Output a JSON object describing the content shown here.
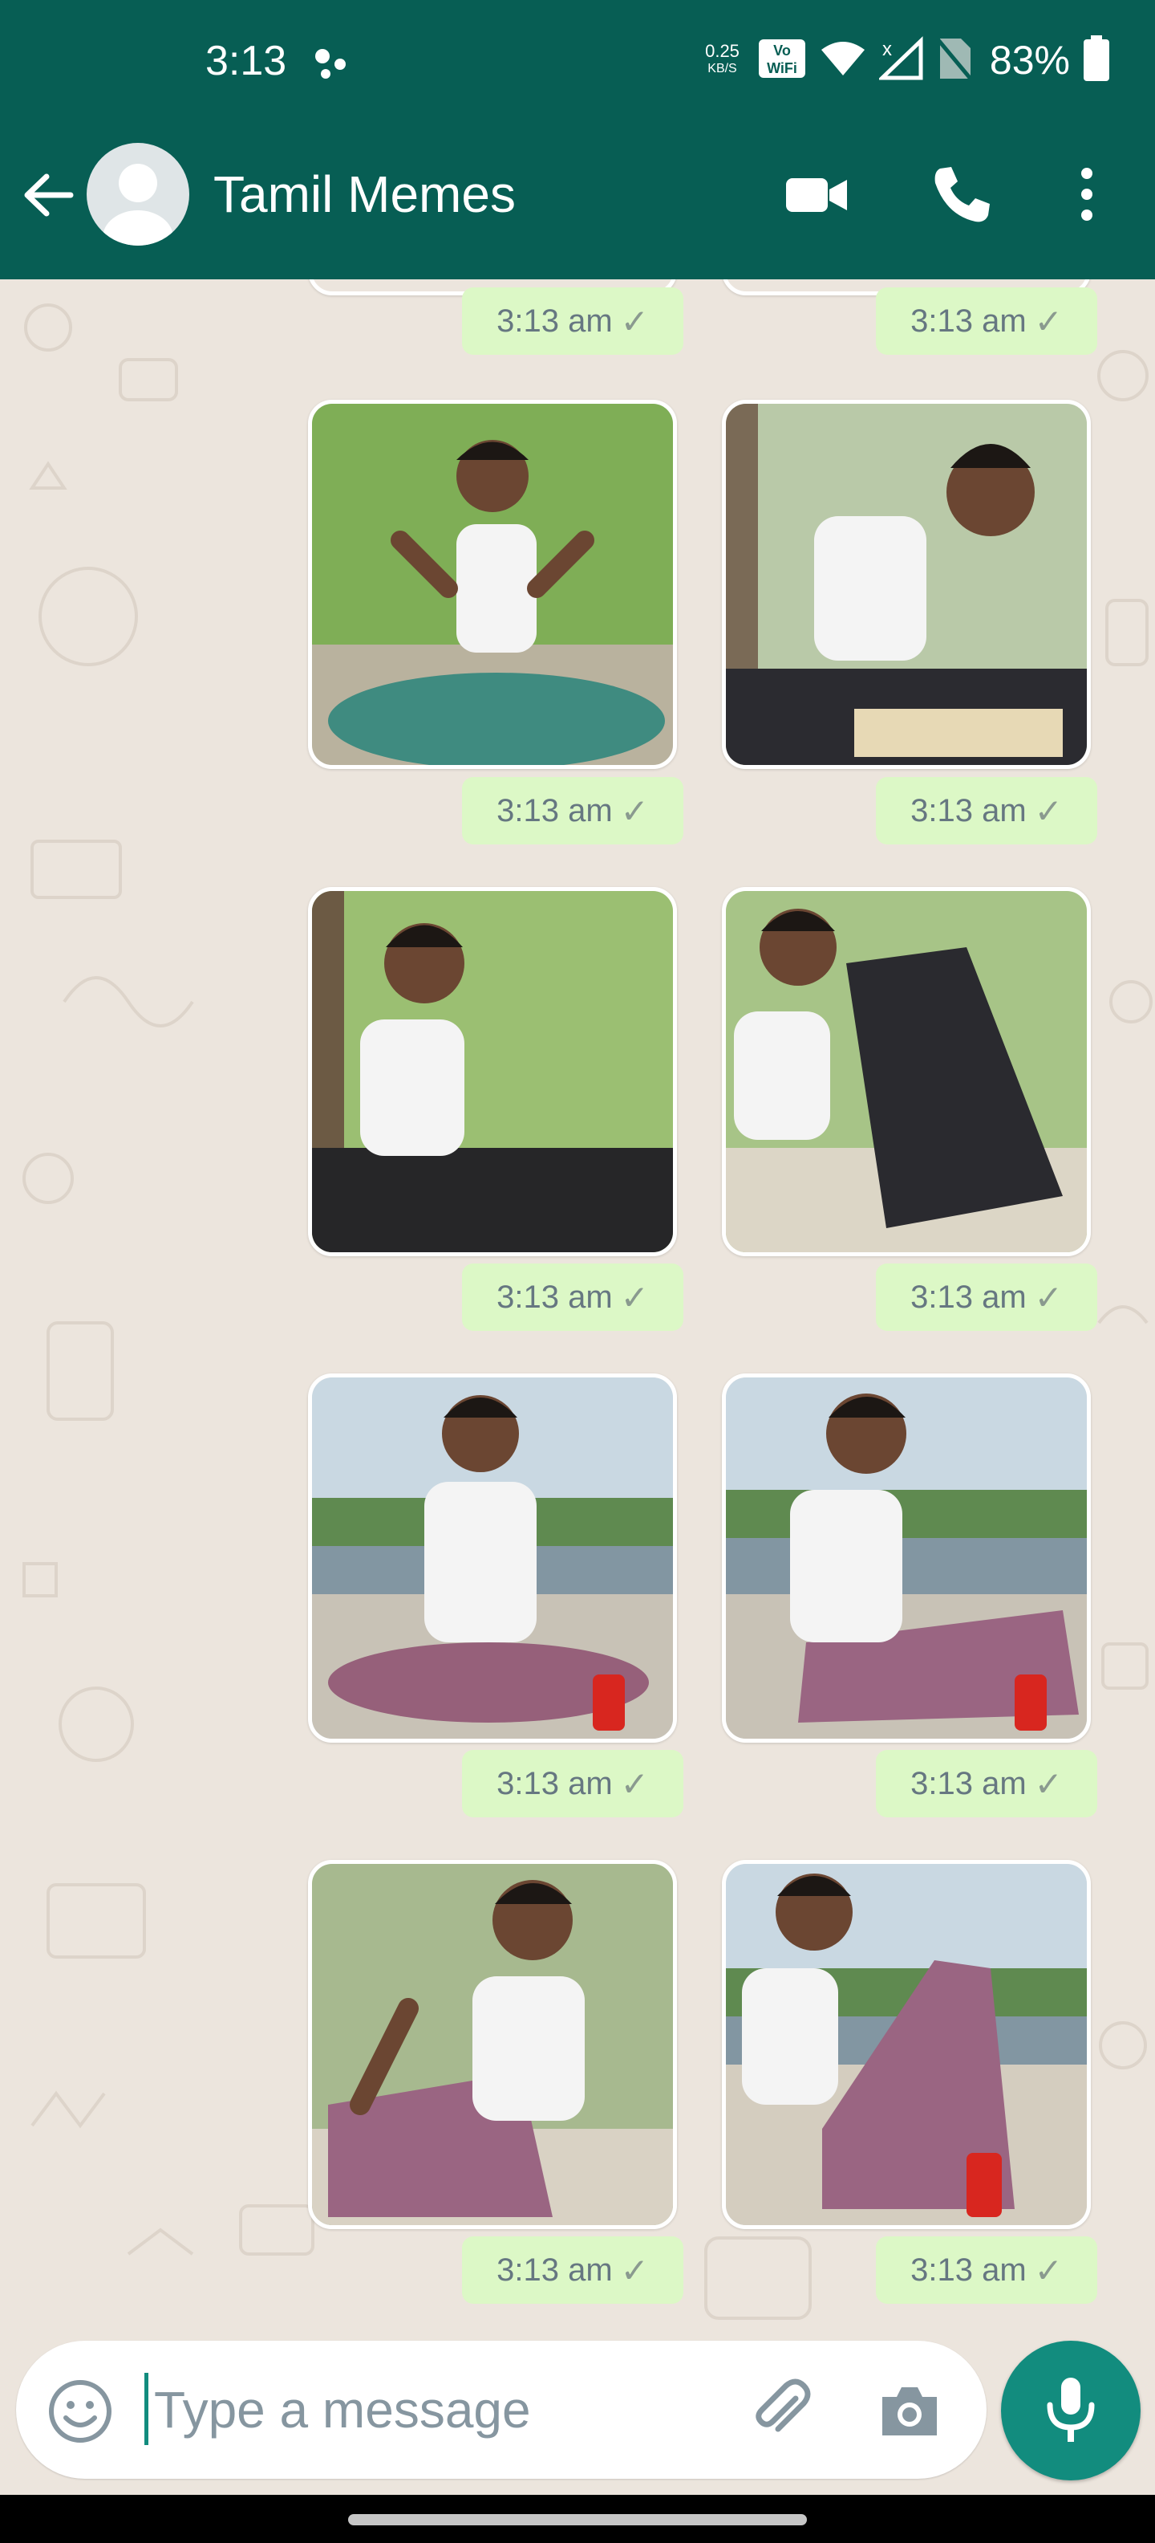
{
  "status_bar": {
    "time": "3:13",
    "net_speed_value": "0.25",
    "net_speed_unit": "KB/S",
    "battery_percent": "83%",
    "icons": [
      "assistant-dots-icon",
      "vowifi-icon",
      "wifi-icon",
      "signal-icon",
      "no-sim-icon",
      "battery-icon"
    ]
  },
  "header": {
    "title": "Tamil Memes",
    "icons": [
      "back-arrow-icon",
      "avatar",
      "video-call-icon",
      "voice-call-icon",
      "more-options-icon"
    ]
  },
  "messages": [
    {
      "time": "3:13 am",
      "status": "✓"
    },
    {
      "time": "3:13 am",
      "status": "✓"
    },
    {
      "time": "3:13 am",
      "status": "✓"
    },
    {
      "time": "3:13 am",
      "status": "✓"
    },
    {
      "time": "3:13 am",
      "status": "✓"
    },
    {
      "time": "3:13 am",
      "status": "✓"
    },
    {
      "time": "3:13 am",
      "status": "✓"
    },
    {
      "time": "3:13 am",
      "status": "✓"
    },
    {
      "time": "3:13 am",
      "status": "✓"
    },
    {
      "time": "3:13 am",
      "status": "✓"
    }
  ],
  "composer": {
    "placeholder": "Type a message",
    "icons": [
      "emoji-icon",
      "attach-icon",
      "camera-icon",
      "mic-icon"
    ]
  },
  "colors": {
    "header": "#075e54",
    "accent": "#128c7e",
    "bubble": "#dcf8c6",
    "wallpaper": "#ece5dd"
  }
}
